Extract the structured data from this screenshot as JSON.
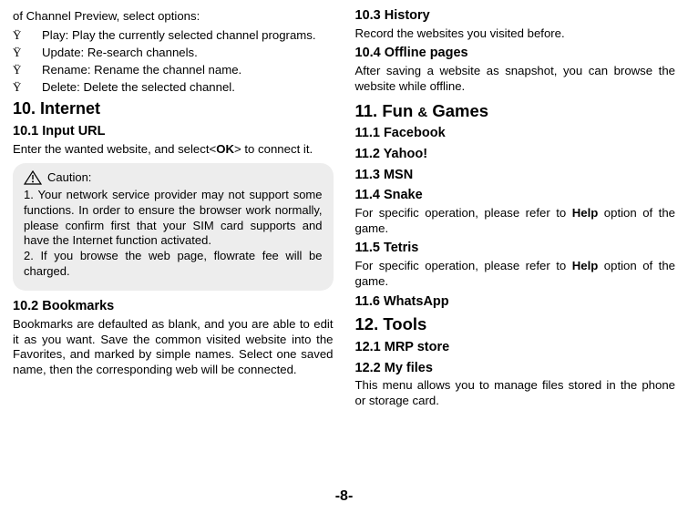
{
  "left": {
    "intro_line": "of Channel Preview, select options:",
    "bullets": [
      {
        "mark": "Ÿ",
        "text": "Play: Play the currently selected channel programs.",
        "hang": true
      },
      {
        "mark": "Ÿ",
        "text": "Update: Re-search channels."
      },
      {
        "mark": "Ÿ",
        "text": "Rename: Rename the channel name."
      },
      {
        "mark": "Ÿ",
        "text": "Delete: Delete the selected channel."
      }
    ],
    "h10": "10. Internet",
    "h10_1": "10.1 Input URL",
    "p10_1_a": "Enter the wanted website, and select<",
    "p10_1_ok": "OK",
    "p10_1_b": "> to connect it.",
    "caution_label": "Caution:",
    "caution_1": "1. Your network service provider may not support some functions. In order to ensure the browser work normally, please confirm first that your SIM card supports and have the Internet function activated.",
    "caution_2": "2. If you browse the web page, flowrate fee will be charged.",
    "h10_2": "10.2 Bookmarks",
    "p10_2": "Bookmarks are defaulted as blank, and you are able to edit it as you want. Save the common visited website into the Favorites, and marked by simple names. Select one saved name, then the corresponding web will be connected."
  },
  "right": {
    "h10_3": "10.3 History",
    "p10_3": "Record the websites you visited before.",
    "h10_4": "10.4 Offline pages",
    "p10_4": "After saving a website as snapshot, you can browse the website while offline.",
    "h11_a": "11. Fun ",
    "h11_amp": "&",
    "h11_b": " Games",
    "h11_1": "11.1 Facebook",
    "h11_2": "11.2 Yahoo!",
    "h11_3": "11.3 MSN",
    "h11_4": "11.4 Snake",
    "p11_4a": "For specific operation, please refer to ",
    "p11_4help": "Help",
    "p11_4b": " option of the game.",
    "h11_5": "11.5 Tetris",
    "p11_5a": "For specific operation, please refer to ",
    "p11_5help": "Help",
    "p11_5b": " option of the game.",
    "h11_6": "11.6 WhatsApp",
    "h12": "12. Tools",
    "h12_1": "12.1 MRP store",
    "h12_2": "12.2 My files",
    "p12_2": "This menu allows you to manage files stored in the phone or storage card."
  },
  "footer": "-8-"
}
